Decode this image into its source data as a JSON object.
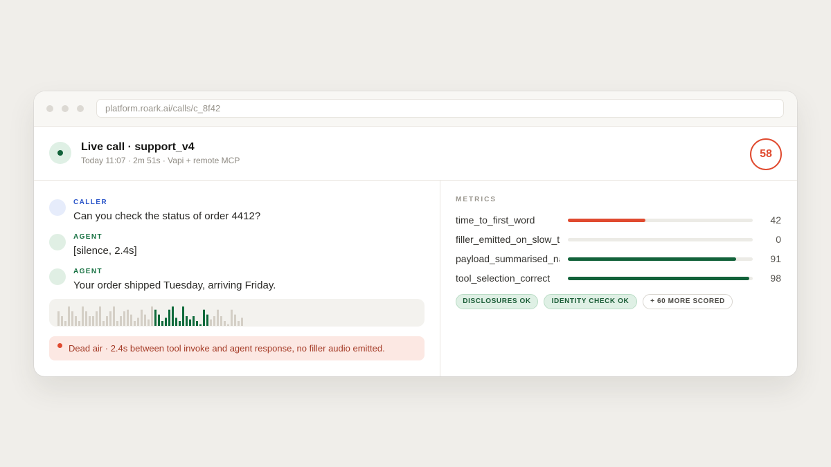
{
  "colors": {
    "background": "#f0eeea",
    "accent_red": "#e04a2f",
    "accent_green": "#12623a",
    "caller_blue": "#2a55c9",
    "wave_gray": "#d4cfc6",
    "wave_active": "#0f6a3b"
  },
  "browser": {
    "url": "platform.roark.ai/calls/c_8f42"
  },
  "call": {
    "status_icon": "live-dot-icon",
    "title": "Live call · support_v4",
    "meta": "Today 11:07 · 2m 51s · Vapi + remote MCP",
    "score": "58"
  },
  "transcript": [
    {
      "role": "CALLER",
      "text": "Can you check the status of order 4412?"
    },
    {
      "role": "AGENT",
      "text": "[silence, 2.4s]"
    },
    {
      "role": "AGENT",
      "text": "Your order shipped Tuesday, arriving Friday."
    }
  ],
  "waveform": {
    "levels": [
      0.45,
      0.3,
      0.15,
      0.6,
      0.45,
      0.3,
      0.15,
      0.6,
      0.45,
      0.3,
      0.3,
      0.45,
      0.6,
      0.15,
      0.3,
      0.45,
      0.6,
      0.15,
      0.3,
      0.45,
      0.5,
      0.35,
      0.15,
      0.25,
      0.5,
      0.35,
      0.2,
      0.6,
      0.5,
      0.35,
      0.15,
      0.25,
      0.5,
      0.6,
      0.25,
      0.15,
      0.6,
      0.3,
      0.2,
      0.3,
      0.15,
      0.05,
      0.5,
      0.35,
      0.2,
      0.3,
      0.5,
      0.3,
      0.15,
      0.05,
      0.5,
      0.35,
      0.15,
      0.25
    ],
    "active_from": 28,
    "active_to": 44
  },
  "alert": {
    "icon": "alert-dot-icon",
    "text": "Dead air · 2.4s between tool invoke and agent response, no filler audio emitted."
  },
  "metrics": {
    "heading": "METRICS",
    "items": [
      {
        "name": "time_to_first_word",
        "value": 42,
        "label": "42",
        "color": "#e04a2f"
      },
      {
        "name": "filler_emitted_on_slow_tool",
        "value": 0,
        "label": "0",
        "color": "#12623a"
      },
      {
        "name": "payload_summarised_naturally",
        "value": 91,
        "label": "91",
        "color": "#12623a"
      },
      {
        "name": "tool_selection_correct",
        "value": 98,
        "label": "98",
        "color": "#12623a"
      }
    ]
  },
  "tags": [
    {
      "label": "DISCLOSURES OK",
      "style": "green"
    },
    {
      "label": "IDENTITY CHECK OK",
      "style": "green"
    },
    {
      "label": "+ 60 MORE SCORED",
      "style": "neutral"
    }
  ]
}
